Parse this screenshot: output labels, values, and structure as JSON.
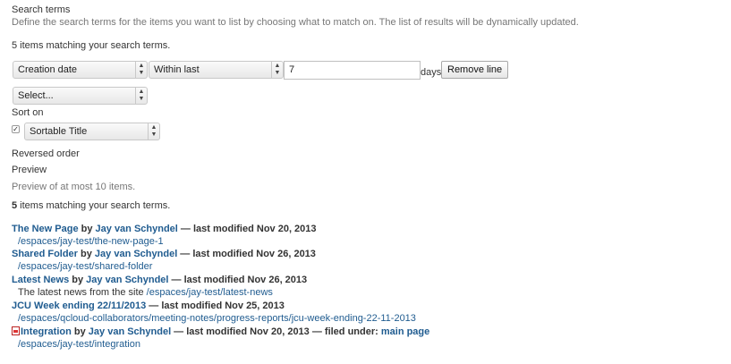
{
  "search_terms": {
    "label": "Search terms",
    "help": "Define the search terms for the items you want to list by choosing what to match on. The list of results will be dynamically updated.",
    "count_text": "5 items matching your search terms."
  },
  "criteria": {
    "field_select": "Creation date",
    "operator_select": "Within last",
    "value_input": "7",
    "unit": "days",
    "remove_button": "Remove line",
    "add_select": "Select..."
  },
  "sort": {
    "label": "Sort on",
    "select": "Sortable Title",
    "reversed_label": "Reversed order",
    "reversed_checked": true
  },
  "preview": {
    "label": "Preview",
    "help": "Preview of at most 10 items.",
    "count_number": "5",
    "count_suffix": " items matching your search terms."
  },
  "results": [
    {
      "title": "The New Page",
      "by": " by ",
      "author": "Jay van Schyndel",
      "modified": " — last modified Nov 20, 2013",
      "description": "",
      "path": "/espaces/jay-test/the-new-page-1",
      "icon": ""
    },
    {
      "title": "Shared Folder",
      "by": " by ",
      "author": "Jay van Schyndel",
      "modified": " — last modified Nov 26, 2013",
      "description": "",
      "path": "/espaces/jay-test/shared-folder",
      "icon": ""
    },
    {
      "title": "Latest News",
      "by": " by ",
      "author": "Jay van Schyndel",
      "modified": " — last modified Nov 26, 2013",
      "description": "The latest news from the site ",
      "path": "/espaces/jay-test/latest-news",
      "icon": ""
    },
    {
      "title": "JCU Week ending 22/11/2013",
      "by": "",
      "author": "",
      "modified": " — last modified Nov 25, 2013",
      "description": "",
      "path": "/espaces/qcloud-collaborators/meeting-notes/progress-reports/jcu-week-ending-22-11-2013",
      "icon": ""
    },
    {
      "title": "Integration",
      "by": " by ",
      "author": "Jay van Schyndel",
      "modified": " — last modified Nov 20, 2013 — filed under: ",
      "filed_under": "main page",
      "description": "",
      "path": "/espaces/jay-test/integration",
      "icon": "pdf-icon"
    }
  ]
}
